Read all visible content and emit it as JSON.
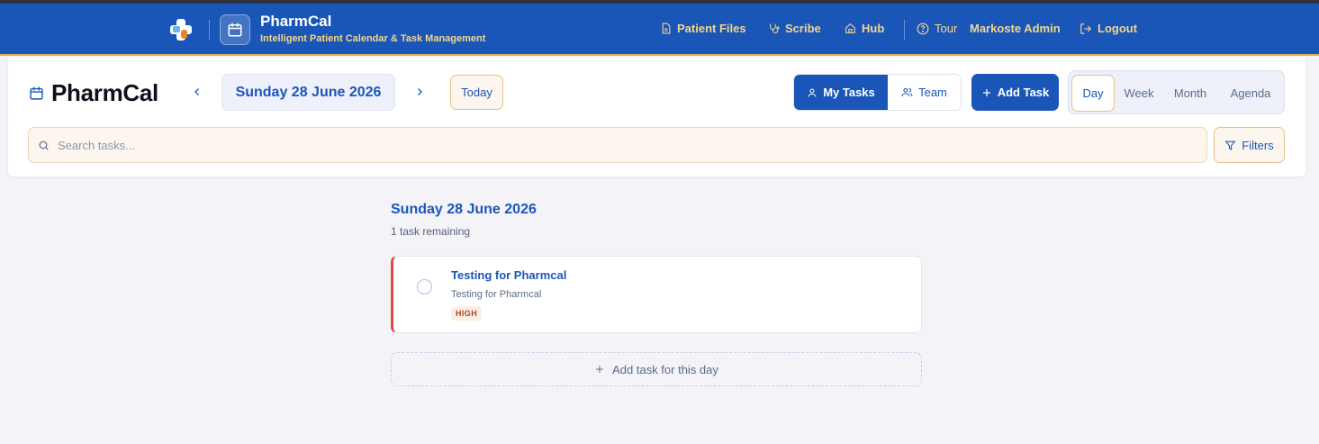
{
  "header": {
    "brand_title": "PharmCal",
    "brand_subtitle": "Intelligent Patient Calendar & Task Management",
    "nav": {
      "patient_files": "Patient Files",
      "scribe": "Scribe",
      "hub": "Hub",
      "tour": "Tour",
      "user": "Markoste Admin",
      "logout": "Logout"
    },
    "colors": {
      "bar": "#1a56b8",
      "accent": "#f2d58a"
    }
  },
  "toolbar": {
    "page_title": "PharmCal",
    "current_date": "Sunday 28 June 2026",
    "today_label": "Today",
    "task_scope": {
      "my_tasks": "My Tasks",
      "team": "Team",
      "selected": "My Tasks"
    },
    "add_task_label": "Add Task",
    "views": [
      "Day",
      "Week",
      "Month",
      "Agenda"
    ],
    "selected_view": "Day",
    "search_placeholder": "Search tasks...",
    "filters_label": "Filters"
  },
  "day": {
    "heading": "Sunday 28 June 2026",
    "remaining": "1 task remaining",
    "tasks": [
      {
        "title": "Testing for Pharmcal",
        "description": "Testing for Pharmcal",
        "priority": "HIGH",
        "completed": false,
        "priority_color": "#e0493f"
      }
    ],
    "add_task_label": "Add task for this day"
  },
  "icons": [
    "logo-cross-icon",
    "calendar-icon",
    "file-icon",
    "stethoscope-icon",
    "home-icon",
    "help-circle-icon",
    "logout-icon",
    "chevron-left-icon",
    "chevron-right-icon",
    "user-icon",
    "users-icon",
    "plus-icon",
    "search-icon",
    "filter-icon"
  ]
}
